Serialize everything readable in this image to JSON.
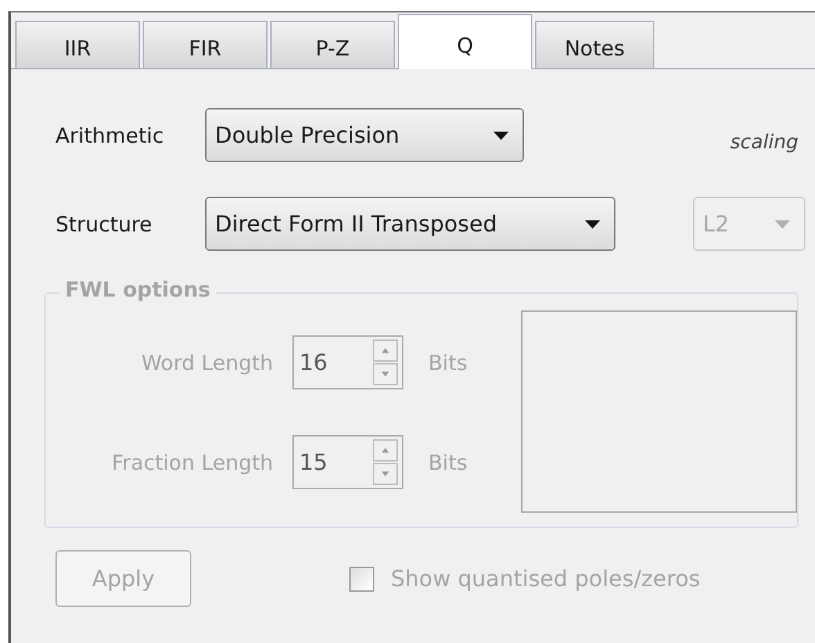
{
  "tabs": [
    {
      "label": "IIR",
      "selected": false
    },
    {
      "label": "FIR",
      "selected": false
    },
    {
      "label": "P-Z",
      "selected": false
    },
    {
      "label": "Q",
      "selected": true
    },
    {
      "label": "Notes",
      "selected": false
    }
  ],
  "arithmetic": {
    "label": "Arithmetic",
    "value": "Double Precision",
    "disabled": false
  },
  "structure": {
    "label": "Structure",
    "value": "Direct Form II Transposed",
    "disabled": false
  },
  "scaling": {
    "label": "scaling",
    "value": "L2",
    "disabled": true
  },
  "fwl_options": {
    "title": "FWL options",
    "disabled": true,
    "fields": [
      {
        "label": "Word Length",
        "value": "16",
        "unit": "Bits"
      },
      {
        "label": "Fraction Length",
        "value": "15",
        "unit": "Bits"
      }
    ]
  },
  "apply_button": {
    "label": "Apply",
    "disabled": true
  },
  "show_quantised": {
    "label": "Show quantised poles/zeros",
    "checked": false,
    "disabled": true
  }
}
